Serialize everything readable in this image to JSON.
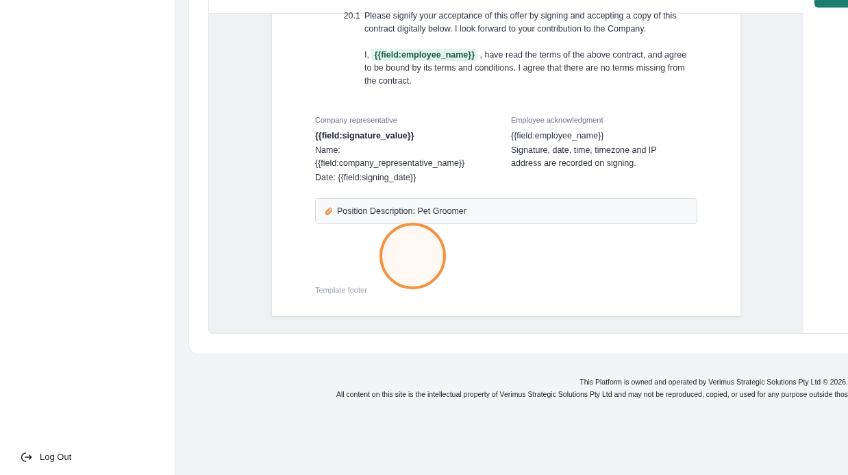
{
  "sidebar": {
    "logout": "Log Out"
  },
  "document": {
    "clause_number": "20.1",
    "clause_text": "Please signify your acceptance of this offer by signing and accepting a copy of this contract digitally below.  I look forward to your contribution to the Company.",
    "ack_prefix": "I,",
    "ack_field": "{{field:employee_name}}",
    "ack_rest": ", have read the terms of the above contract, and agree to be bound by its terms and conditions. I agree that there are no terms missing from the contract.",
    "signatures": [
      {
        "heading": "Company representative",
        "lines": [
          {
            "text": "{{field:signature_value}}",
            "bold": true
          },
          {
            "text": "Name: {{field:company_representative_name}}",
            "bold": false
          },
          {
            "text": "Date: {{field:signing_date}}",
            "bold": false
          }
        ]
      },
      {
        "heading": "Employee acknowledgment",
        "lines": [
          {
            "text": "{{field:employee_name}}",
            "bold": false
          },
          {
            "text": "Signature, date, time, timezone and IP address are recorded on signing.",
            "bold": false
          }
        ]
      }
    ],
    "attachment": "Position Description: Pet Groomer",
    "footer": "Template footer"
  },
  "page_footer": [
    "This Platform is owned and operated by Verimus Strategic Solutions Pty Ltd © 2026.",
    "All content on this site is the intellectual property of Verimus Strategic Solutions Pty Ltd and may not be reproduced, copied, or used for any purpose outside thos"
  ]
}
